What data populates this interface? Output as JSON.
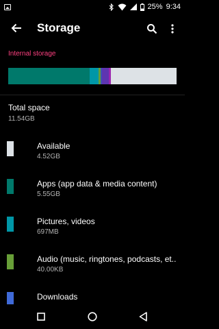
{
  "status": {
    "battery": "25%",
    "time": "9:34"
  },
  "appbar": {
    "title": "Storage"
  },
  "storage": {
    "section_label": "Internal storage",
    "bar_segments": [
      {
        "name": "apps",
        "color": "#00796b",
        "fraction": 0.482
      },
      {
        "name": "pictures-videos",
        "color": "#0097a7",
        "fraction": 0.055
      },
      {
        "name": "audio",
        "color": "#689f38",
        "fraction": 0.01
      },
      {
        "name": "downloads",
        "color": "#3f51b5",
        "fraction": 0.01
      },
      {
        "name": "cached",
        "color": "#5e35b1",
        "fraction": 0.04
      },
      {
        "name": "misc",
        "color": "#9c27b0",
        "fraction": 0.012
      },
      {
        "name": "available",
        "color": "#dde2e6",
        "fraction": 0.391
      }
    ],
    "total": {
      "title": "Total space",
      "value": "11.54GB"
    },
    "items": [
      {
        "title": "Available",
        "size": "4.52GB",
        "color": "#dde2e6"
      },
      {
        "title": "Apps (app data & media content)",
        "size": "5.55GB",
        "color": "#00796b"
      },
      {
        "title": "Pictures, videos",
        "size": "697MB",
        "color": "#0097a7"
      },
      {
        "title": "Audio (music, ringtones, podcasts, et..",
        "size": "40.00KB",
        "color": "#689f38"
      },
      {
        "title": "Downloads",
        "size": "",
        "color": "#3f6ad8"
      }
    ]
  }
}
